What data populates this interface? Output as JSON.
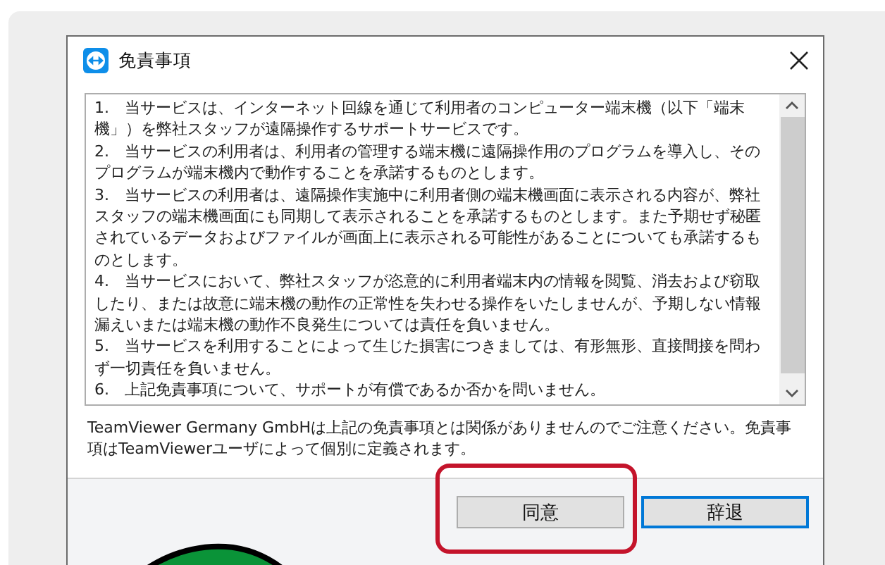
{
  "window": {
    "title": "免責事項"
  },
  "terms": [
    "1.　当サービスは、インターネット回線を通じて利用者のコンピューター端末機（以下「端末機」）を弊社スタッフが遠隔操作するサポートサービスです。",
    "2.　当サービスの利用者は、利用者の管理する端末機に遠隔操作用のプログラムを導入し、そのプログラムが端末機内で動作することを承諾するものとします。",
    "3.　当サービスの利用者は、遠隔操作実施中に利用者側の端末機画面に表示される内容が、弊社スタッフの端末機画面にも同期して表示されることを承諾するものとします。また予期せず秘匿されているデータおよびファイルが画面上に表示される可能性があることについても承諾するものとします。",
    "4.　当サービスにおいて、弊社スタッフが恣意的に利用者端末内の情報を閲覧、消去および窃取したり、または故意に端末機の動作の正常性を失わせる操作をいたしませんが、予期しない情報漏えいまたは端末機の動作不良発生については責任を負いません。",
    "5.　当サービスを利用することによって生じた損害につきましては、有形無形、直接間接を問わず一切責任を負いません。",
    "6.　上記免責事項について、サポートが有償であるか否かを問いません。"
  ],
  "note": "TeamViewer Germany GmbHは上記の免責事項とは関係がありませんのでご注意ください。免責事項はTeamViewerユーザによって個別に定義されます。",
  "buttons": [
    {
      "label": "同意",
      "highlighted": true,
      "focused": false
    },
    {
      "label": "辞退",
      "highlighted": false,
      "focused": true
    }
  ]
}
